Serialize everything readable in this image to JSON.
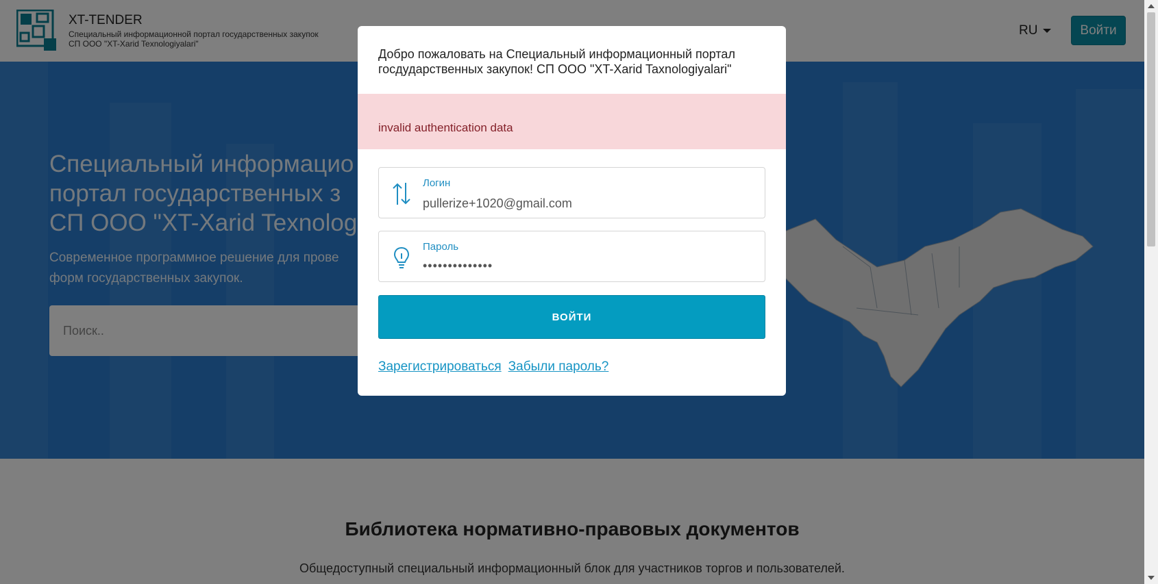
{
  "header": {
    "brand_title": "XT-TENDER",
    "brand_subtitle_1": "Специальный информационной портал государственных закупок",
    "brand_subtitle_2": "СП ООО \"XT-Xarid Texnologiyalari\"",
    "language": "RU",
    "login_label": "Войти"
  },
  "hero": {
    "title": "Специальный информацио\nпортал государственных з\nСП ООО \"XT-Xarid Texnologi",
    "description": "Современное программное решение для прове\nформ государственных закупок.",
    "search_placeholder": "Поиск.."
  },
  "library": {
    "title": "Библиотека нормативно-правовых документов",
    "subtitle": "Общедоступный специальный информационный блок для участников торгов и пользователей."
  },
  "modal": {
    "welcome": "Добро пожаловать на Специальный информационный портал госдударственных закупок! СП ООО \"XT-Xarid Taxnologiyalari\"",
    "error": "invalid authentication data",
    "login_label": "Логин",
    "login_value": "pullerize+1020@gmail.com",
    "password_label": "Пароль",
    "password_value": "••••••••••••••",
    "submit_label": "ВОЙТИ",
    "register_link": "Зарегистрироваться",
    "forgot_link": "Забыли пароль?"
  },
  "colors": {
    "brand": "#0a8da5",
    "hero_bg": "#2a7dd1",
    "alert_bg": "#f8d7da",
    "alert_text": "#842029",
    "submit_bg": "#049cc0",
    "link": "#1694c4"
  },
  "icons": {
    "logo": "squares-logo-icon",
    "login_field": "swap-vertical-icon",
    "password_field": "lightbulb-icon",
    "language_caret": "chevron-down-icon"
  }
}
